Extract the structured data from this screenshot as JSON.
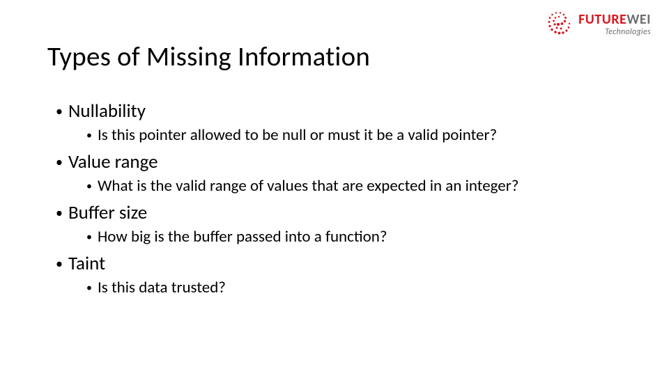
{
  "logo": {
    "word_a": "FUTURE",
    "word_b": "WEI",
    "subline": "Technologies"
  },
  "title": "Types of Missing Information",
  "items": [
    {
      "label": "Nullability",
      "sub": "Is this pointer allowed to be null or must it be a valid pointer?"
    },
    {
      "label": "Value range",
      "sub": "What is the valid range of values that are expected in an integer?"
    },
    {
      "label": "Buffer size",
      "sub": "How big is the buffer passed into a function?"
    },
    {
      "label": "Taint",
      "sub": "Is this data trusted?"
    }
  ]
}
